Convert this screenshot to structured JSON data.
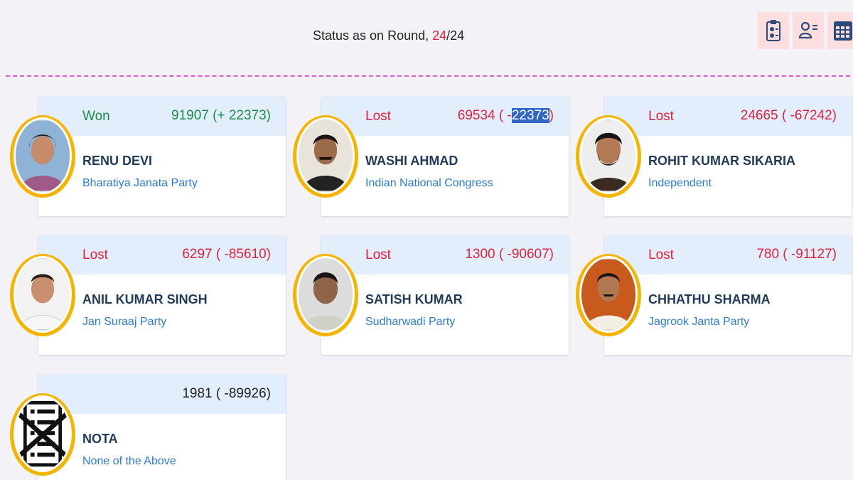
{
  "status": {
    "prefix": "Status as on Round, ",
    "current_round": "24",
    "separator": "/",
    "total_rounds": "24"
  },
  "toolbar": {
    "icons": [
      "clipboard-icon",
      "candidate-list-icon",
      "table-grid-icon"
    ]
  },
  "candidates": [
    {
      "result": "Won",
      "votes": "91907 (+ 22373)",
      "name": "RENU DEVI",
      "party": "Bharatiya Janata Party",
      "status_color": "#1e8c45"
    },
    {
      "result": "Lost",
      "votes_prefix": "69534 ( -",
      "votes_highlight": "22373",
      "votes_suffix": ")",
      "name": "WASHI AHMAD",
      "party": "Indian National Congress",
      "status_color": "#e0213a"
    },
    {
      "result": "Lost",
      "votes": "24665 ( -67242)",
      "name": "ROHIT KUMAR SIKARIA",
      "party": "Independent",
      "status_color": "#e0213a"
    },
    {
      "result": "Lost",
      "votes": "6297 ( -85610)",
      "name": "ANIL KUMAR SINGH",
      "party": "Jan Suraaj Party",
      "status_color": "#e0213a"
    },
    {
      "result": "Lost",
      "votes": "1300 ( -90607)",
      "name": "SATISH KUMAR",
      "party": "Sudharwadi Party",
      "status_color": "#e0213a"
    },
    {
      "result": "Lost",
      "votes": "780 ( -91127)",
      "name": "CHHATHU SHARMA",
      "party": "Jagrook Janta Party",
      "status_color": "#e0213a"
    },
    {
      "result": "",
      "votes": "1981 ( -89926)",
      "name": "NOTA",
      "party": "None of the Above",
      "status_color": "#222222"
    }
  ]
}
